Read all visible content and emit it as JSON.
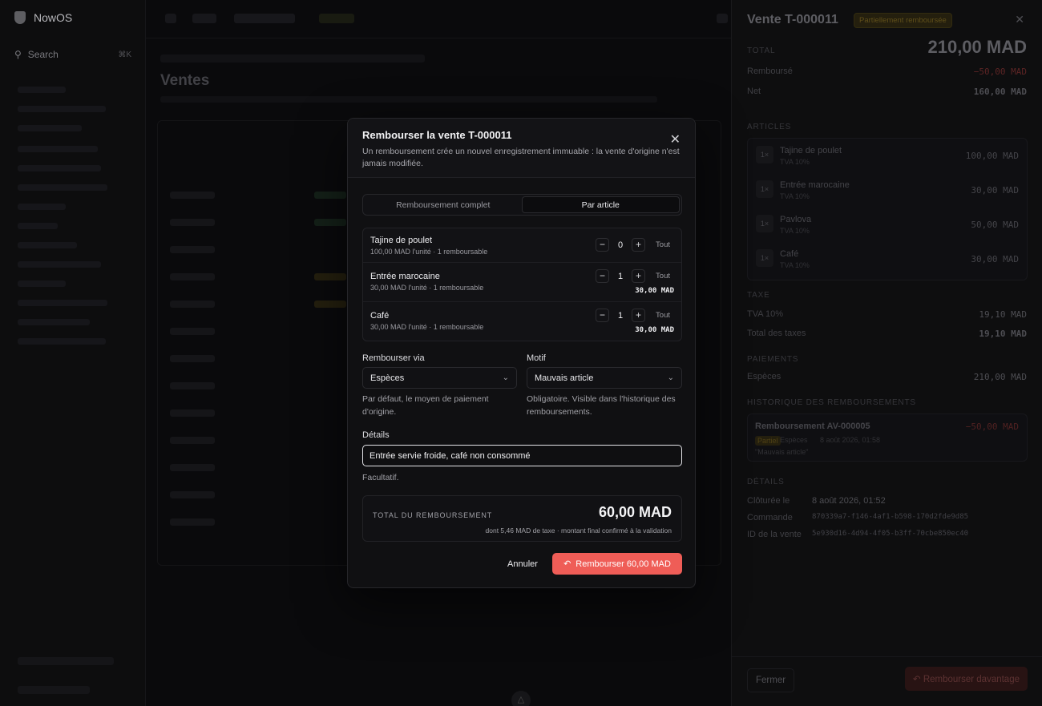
{
  "app": {
    "name": "NowOS",
    "search_label": "Search"
  },
  "main": {
    "title": "Ventes",
    "crumb_current": "Ventes"
  },
  "sale_panel": {
    "title": "Vente T-000011",
    "status_badge": "Partiellement remboursée",
    "summary": {
      "total_label": "TOTAL",
      "total_value": "210,00 MAD",
      "refunded_label": "Remboursé",
      "refunded_value": "−50,00 MAD",
      "net_label": "Net",
      "net_value": "160,00 MAD"
    },
    "articles_label": "ARTICLES",
    "articles": [
      {
        "qty": "1×",
        "name": "Tajine de poulet",
        "tax": "TVA 10%",
        "price": "100,00 MAD"
      },
      {
        "qty": "1×",
        "name": "Entrée marocaine",
        "tax": "TVA 10%",
        "price": "30,00 MAD"
      },
      {
        "qty": "1×",
        "name": "Pavlova",
        "tax": "TVA 10%",
        "price": "50,00 MAD"
      },
      {
        "qty": "1×",
        "name": "Café",
        "tax": "TVA 10%",
        "price": "30,00 MAD"
      }
    ],
    "taxes_label": "TAXE",
    "tax_rate_label": "TVA 10%",
    "tax_rate_value": "19,10 MAD",
    "tax_total_label": "Total des taxes",
    "tax_total_value": "19,10 MAD",
    "payments_label": "PAIEMENTS",
    "payment_method": "Espèces",
    "payment_value": "210,00 MAD",
    "history_label": "HISTORIQUE DES REMBOURSEMENTS",
    "history": {
      "title": "Remboursement AV-000005",
      "amount": "−50,00 MAD",
      "tag": "Partiel",
      "method": "Espèces",
      "date": "8 août 2026, 01:58",
      "reason": "\"Mauvais article\""
    },
    "details_label": "DÉTAILS",
    "details": [
      {
        "label": "Clôturée le",
        "value": "8 août 2026, 01:52"
      },
      {
        "label": "Commande",
        "value": "870339a7-f146-4af1-b598-170d2fde9d85"
      },
      {
        "label": "ID de la vente",
        "value": "5e930d16-4d94-4f05-b3ff-70cbe850ec40"
      }
    ],
    "close_button": "Fermer",
    "refund_more_button": "Rembourser davantage"
  },
  "modal": {
    "title": "Rembourser la vente T-000011",
    "description": "Un remboursement crée un nouvel enregistrement immuable : la vente d'origine n'est jamais modifiée.",
    "tabs": [
      {
        "label": "Remboursement complet"
      },
      {
        "label": "Par article"
      }
    ],
    "items": [
      {
        "name": "Tajine de poulet",
        "sub": "100,00 MAD l'unité · 1 remboursable",
        "qty": "0",
        "all": "Tout",
        "amount": ""
      },
      {
        "name": "Entrée marocaine",
        "sub": "30,00 MAD l'unité · 1 remboursable",
        "qty": "1",
        "all": "Tout",
        "amount": "30,00 MAD"
      },
      {
        "name": "Café",
        "sub": "30,00 MAD l'unité · 1 remboursable",
        "qty": "1",
        "all": "Tout",
        "amount": "30,00 MAD"
      }
    ],
    "via_label": "Rembourser via",
    "via_value": "Espèces",
    "via_help": "Par défaut, le moyen de paiement d'origine.",
    "reason_label": "Motif",
    "reason_value": "Mauvais article",
    "reason_help": "Obligatoire. Visible dans l'historique des remboursements.",
    "details_label": "Détails",
    "details_value": "Entrée servie froide, café non consommé",
    "details_help": "Facultatif.",
    "total_label": "TOTAL DU REMBOURSEMENT",
    "total_value": "60,00 MAD",
    "total_sub": "dont 5,46 MAD de taxe · montant final confirmé à la validation",
    "cancel_button": "Annuler",
    "confirm_button": "Rembourser 60,00 MAD"
  },
  "colors": {
    "accent_refund": "#ef5d57",
    "bg": "#0c0c0e",
    "surface": "#101012"
  }
}
